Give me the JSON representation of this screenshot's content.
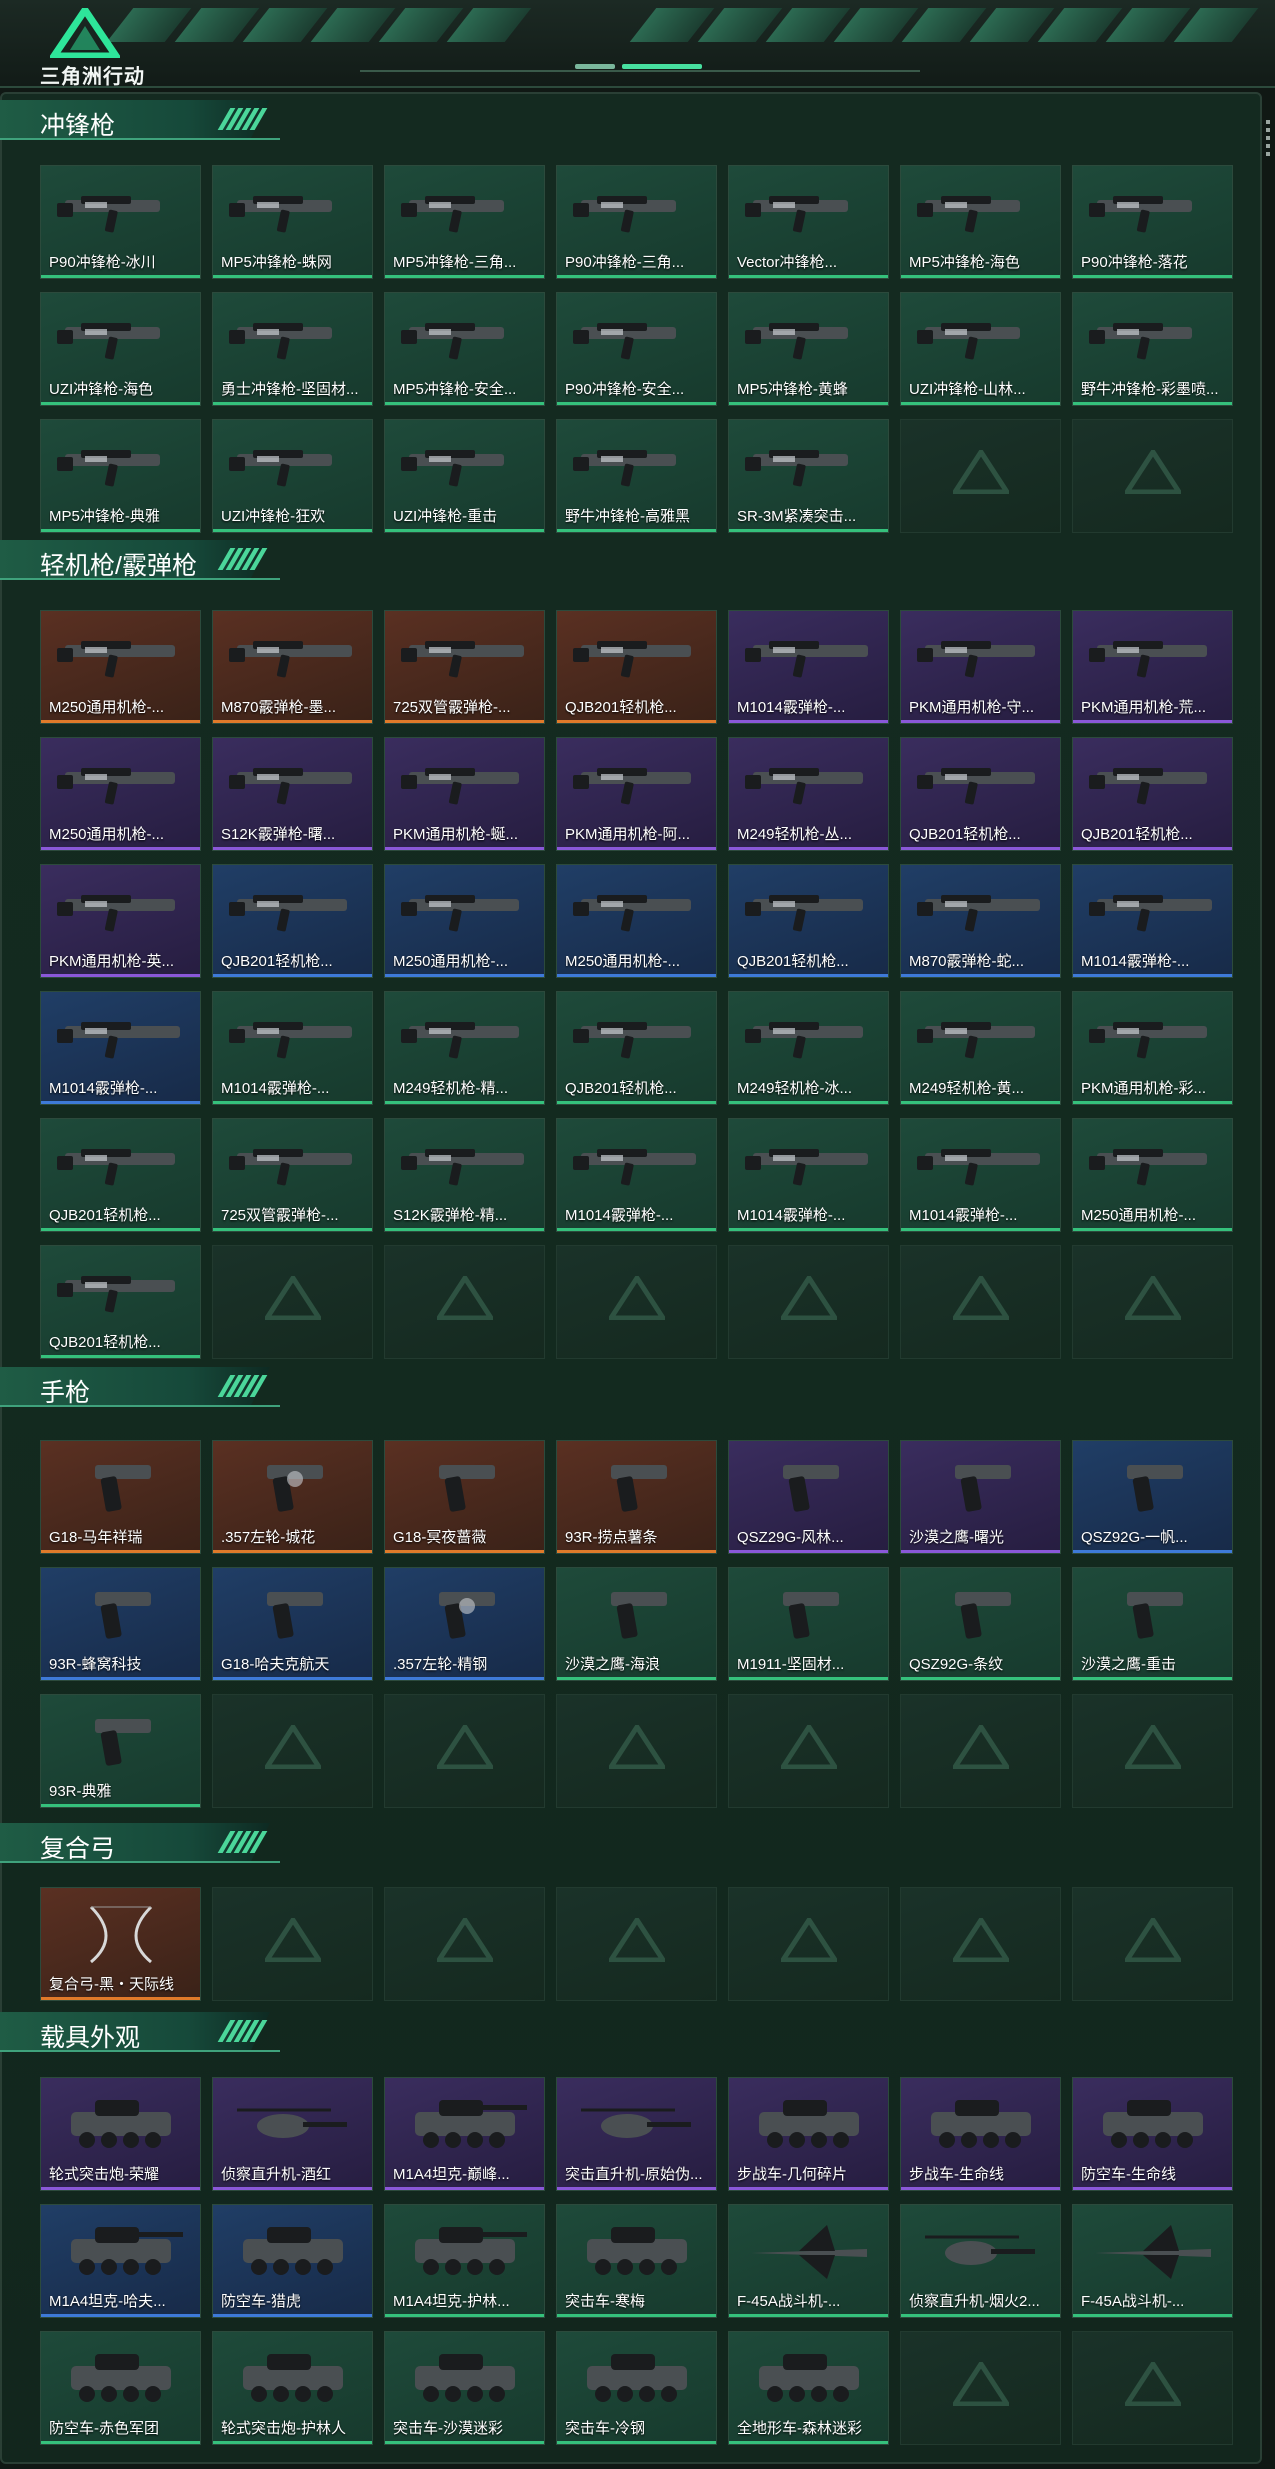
{
  "app": {
    "logo_text": "三角洲行动"
  },
  "colors": {
    "accent": "#4bd69a",
    "rarity_green": "#35c17c",
    "rarity_orange": "#e07a2a",
    "rarity_purple": "#8a58d8",
    "rarity_blue": "#3e7ad8"
  },
  "sections": [
    {
      "title": "冲锋枪",
      "items": [
        {
          "name": "P90冲锋枪-冰川",
          "rarity": "green",
          "icon": "smg-icon"
        },
        {
          "name": "MP5冲锋枪-蛛网",
          "rarity": "green",
          "icon": "smg-icon"
        },
        {
          "name": "MP5冲锋枪-三角...",
          "rarity": "green",
          "icon": "smg-icon"
        },
        {
          "name": "P90冲锋枪-三角...",
          "rarity": "green",
          "icon": "smg-icon"
        },
        {
          "name": "Vector冲锋枪...",
          "rarity": "green",
          "icon": "smg-icon"
        },
        {
          "name": "MP5冲锋枪-海色",
          "rarity": "green",
          "icon": "smg-icon"
        },
        {
          "name": "P90冲锋枪-落花",
          "rarity": "green",
          "icon": "smg-icon"
        },
        {
          "name": "UZI冲锋枪-海色",
          "rarity": "green",
          "icon": "smg-icon"
        },
        {
          "name": "勇士冲锋枪-坚固材...",
          "rarity": "green",
          "icon": "smg-icon"
        },
        {
          "name": "MP5冲锋枪-安全...",
          "rarity": "green",
          "icon": "smg-icon"
        },
        {
          "name": "P90冲锋枪-安全...",
          "rarity": "green",
          "icon": "smg-icon"
        },
        {
          "name": "MP5冲锋枪-黄蜂",
          "rarity": "green",
          "icon": "smg-icon"
        },
        {
          "name": "UZI冲锋枪-山林...",
          "rarity": "green",
          "icon": "smg-icon"
        },
        {
          "name": "野牛冲锋枪-彩墨喷...",
          "rarity": "green",
          "icon": "smg-icon"
        },
        {
          "name": "MP5冲锋枪-典雅",
          "rarity": "green",
          "icon": "smg-icon"
        },
        {
          "name": "UZI冲锋枪-狂欢",
          "rarity": "green",
          "icon": "smg-icon"
        },
        {
          "name": "UZI冲锋枪-重击",
          "rarity": "green",
          "icon": "smg-icon"
        },
        {
          "name": "野牛冲锋枪-高雅黑",
          "rarity": "green",
          "icon": "smg-icon"
        },
        {
          "name": "SR-3M紧凑突击...",
          "rarity": "green",
          "icon": "smg-icon"
        }
      ],
      "slots": 21
    },
    {
      "title": "轻机枪/霰弹枪",
      "items": [
        {
          "name": "M250通用机枪-...",
          "rarity": "orange",
          "icon": "lmg-icon"
        },
        {
          "name": "M870霰弹枪-墨...",
          "rarity": "orange",
          "icon": "shotgun-icon"
        },
        {
          "name": "725双管霰弹枪-...",
          "rarity": "orange",
          "icon": "shotgun-icon"
        },
        {
          "name": "QJB201轻机枪...",
          "rarity": "orange",
          "icon": "lmg-icon"
        },
        {
          "name": "M1014霰弹枪-...",
          "rarity": "purple",
          "icon": "shotgun-icon"
        },
        {
          "name": "PKM通用机枪-守...",
          "rarity": "purple",
          "icon": "lmg-icon"
        },
        {
          "name": "PKM通用机枪-荒...",
          "rarity": "purple",
          "icon": "lmg-icon"
        },
        {
          "name": "M250通用机枪-...",
          "rarity": "purple",
          "icon": "lmg-icon"
        },
        {
          "name": "S12K霰弹枪-曙...",
          "rarity": "purple",
          "icon": "shotgun-icon"
        },
        {
          "name": "PKM通用机枪-蜒...",
          "rarity": "purple",
          "icon": "lmg-icon"
        },
        {
          "name": "PKM通用机枪-阿...",
          "rarity": "purple",
          "icon": "lmg-icon"
        },
        {
          "name": "M249轻机枪-丛...",
          "rarity": "purple",
          "icon": "lmg-icon"
        },
        {
          "name": "QJB201轻机枪...",
          "rarity": "purple",
          "icon": "lmg-icon"
        },
        {
          "name": "QJB201轻机枪...",
          "rarity": "purple",
          "icon": "lmg-icon"
        },
        {
          "name": "PKM通用机枪-英...",
          "rarity": "purple",
          "icon": "lmg-icon"
        },
        {
          "name": "QJB201轻机枪...",
          "rarity": "blue",
          "icon": "lmg-icon"
        },
        {
          "name": "M250通用机枪-...",
          "rarity": "blue",
          "icon": "lmg-icon"
        },
        {
          "name": "M250通用机枪-...",
          "rarity": "blue",
          "icon": "lmg-icon"
        },
        {
          "name": "QJB201轻机枪...",
          "rarity": "blue",
          "icon": "lmg-icon"
        },
        {
          "name": "M870霰弹枪-蛇...",
          "rarity": "blue",
          "icon": "shotgun-icon"
        },
        {
          "name": "M1014霰弹枪-...",
          "rarity": "blue",
          "icon": "shotgun-icon"
        },
        {
          "name": "M1014霰弹枪-...",
          "rarity": "blue",
          "icon": "shotgun-icon"
        },
        {
          "name": "M1014霰弹枪-...",
          "rarity": "green",
          "icon": "shotgun-icon"
        },
        {
          "name": "M249轻机枪-精...",
          "rarity": "green",
          "icon": "lmg-icon"
        },
        {
          "name": "QJB201轻机枪...",
          "rarity": "green",
          "icon": "lmg-icon"
        },
        {
          "name": "M249轻机枪-冰...",
          "rarity": "green",
          "icon": "lmg-icon"
        },
        {
          "name": "M249轻机枪-黄...",
          "rarity": "green",
          "icon": "lmg-icon"
        },
        {
          "name": "PKM通用机枪-彩...",
          "rarity": "green",
          "icon": "lmg-icon"
        },
        {
          "name": "QJB201轻机枪...",
          "rarity": "green",
          "icon": "lmg-icon"
        },
        {
          "name": "725双管霰弹枪-...",
          "rarity": "green",
          "icon": "shotgun-icon"
        },
        {
          "name": "S12K霰弹枪-精...",
          "rarity": "green",
          "icon": "shotgun-icon"
        },
        {
          "name": "M1014霰弹枪-...",
          "rarity": "green",
          "icon": "shotgun-icon"
        },
        {
          "name": "M1014霰弹枪-...",
          "rarity": "green",
          "icon": "shotgun-icon"
        },
        {
          "name": "M1014霰弹枪-...",
          "rarity": "green",
          "icon": "shotgun-icon"
        },
        {
          "name": "M250通用机枪-...",
          "rarity": "green",
          "icon": "lmg-icon"
        },
        {
          "name": "QJB201轻机枪...",
          "rarity": "green",
          "icon": "lmg-icon"
        }
      ],
      "slots": 42
    },
    {
      "title": "手枪",
      "items": [
        {
          "name": "G18-马年祥瑞",
          "rarity": "orange",
          "icon": "pistol-icon"
        },
        {
          "name": ".357左轮-城花",
          "rarity": "orange",
          "icon": "revolver-icon"
        },
        {
          "name": "G18-冥夜蔷薇",
          "rarity": "orange",
          "icon": "pistol-icon"
        },
        {
          "name": "93R-捞点薯条",
          "rarity": "orange",
          "icon": "pistol-icon"
        },
        {
          "name": "QSZ29G-风林...",
          "rarity": "purple",
          "icon": "pistol-icon"
        },
        {
          "name": "沙漠之鹰-曙光",
          "rarity": "purple",
          "icon": "pistol-icon"
        },
        {
          "name": "QSZ92G-一帆...",
          "rarity": "blue",
          "icon": "pistol-icon"
        },
        {
          "name": "93R-蜂窝科技",
          "rarity": "blue",
          "icon": "pistol-icon"
        },
        {
          "name": "G18-哈夫克航天",
          "rarity": "blue",
          "icon": "pistol-icon"
        },
        {
          "name": ".357左轮-精钢",
          "rarity": "blue",
          "icon": "revolver-icon"
        },
        {
          "name": "沙漠之鹰-海浪",
          "rarity": "green",
          "icon": "pistol-icon"
        },
        {
          "name": "M1911-坚固材...",
          "rarity": "green",
          "icon": "pistol-icon"
        },
        {
          "name": "QSZ92G-条纹",
          "rarity": "green",
          "icon": "pistol-icon"
        },
        {
          "name": "沙漠之鹰-重击",
          "rarity": "green",
          "icon": "pistol-icon"
        },
        {
          "name": "93R-典雅",
          "rarity": "green",
          "icon": "pistol-icon"
        }
      ],
      "slots": 21
    },
    {
      "title": "复合弓",
      "items": [
        {
          "name": "复合弓-黑・天际线",
          "rarity": "orange",
          "icon": "bow-icon"
        }
      ],
      "slots": 7
    },
    {
      "title": "载具外观",
      "items": [
        {
          "name": "轮式突击炮-荣耀",
          "rarity": "purple",
          "icon": "armored-car-icon"
        },
        {
          "name": "侦察直升机-酒红",
          "rarity": "purple",
          "icon": "helicopter-icon"
        },
        {
          "name": "M1A4坦克-巅峰...",
          "rarity": "purple",
          "icon": "tank-icon"
        },
        {
          "name": "突击直升机-原始伪...",
          "rarity": "purple",
          "icon": "helicopter-icon"
        },
        {
          "name": "步战车-几何碎片",
          "rarity": "purple",
          "icon": "ifv-icon"
        },
        {
          "name": "步战车-生命线",
          "rarity": "purple",
          "icon": "ifv-icon"
        },
        {
          "name": "防空车-生命线",
          "rarity": "purple",
          "icon": "ifv-icon"
        },
        {
          "name": "M1A4坦克-哈夫...",
          "rarity": "blue",
          "icon": "tank-icon"
        },
        {
          "name": "防空车-猎虎",
          "rarity": "blue",
          "icon": "ifv-icon"
        },
        {
          "name": "M1A4坦克-护林...",
          "rarity": "green",
          "icon": "tank-icon"
        },
        {
          "name": "突击车-寒梅",
          "rarity": "green",
          "icon": "armored-car-icon"
        },
        {
          "name": "F-45A战斗机-...",
          "rarity": "green",
          "icon": "jet-icon"
        },
        {
          "name": "侦察直升机-烟火2...",
          "rarity": "green",
          "icon": "helicopter-icon"
        },
        {
          "name": "F-45A战斗机-...",
          "rarity": "green",
          "icon": "jet-icon"
        },
        {
          "name": "防空车-赤色军团",
          "rarity": "green",
          "icon": "ifv-icon"
        },
        {
          "name": "轮式突击炮-护林人",
          "rarity": "green",
          "icon": "armored-car-icon"
        },
        {
          "name": "突击车-沙漠迷彩",
          "rarity": "green",
          "icon": "armored-car-icon"
        },
        {
          "name": "突击车-冷钢",
          "rarity": "green",
          "icon": "armored-car-icon"
        },
        {
          "name": "全地形车-森林迷彩",
          "rarity": "green",
          "icon": "atv-icon"
        }
      ],
      "slots": 21
    }
  ]
}
